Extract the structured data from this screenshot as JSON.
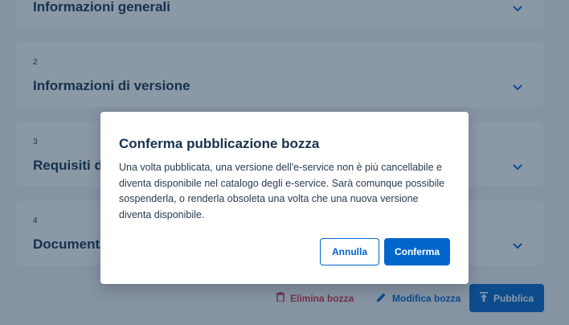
{
  "sections": [
    {
      "number": "",
      "title": "Informazioni generali"
    },
    {
      "number": "2",
      "title": "Informazioni di versione"
    },
    {
      "number": "3",
      "title": "Requisiti di"
    },
    {
      "number": "4",
      "title": "Documenta"
    }
  ],
  "actions": {
    "delete_label": "Elimina bozza",
    "edit_label": "Modifica bozza",
    "publish_label": "Pubblica"
  },
  "dialog": {
    "title": "Conferma pubblicazione bozza",
    "body": "Una volta pubblicata, una versione dell'e-service non è più cancellabile e diventa disponibile nel catalogo degli e-service. Sarà comunque possibile sospenderla, o renderla obsoleta una volta che una nuova versione diventa disponibile.",
    "cancel_label": "Annulla",
    "confirm_label": "Conferma"
  },
  "colors": {
    "primary": "#0066cc",
    "danger": "#d1344c",
    "text": "#17324d"
  }
}
